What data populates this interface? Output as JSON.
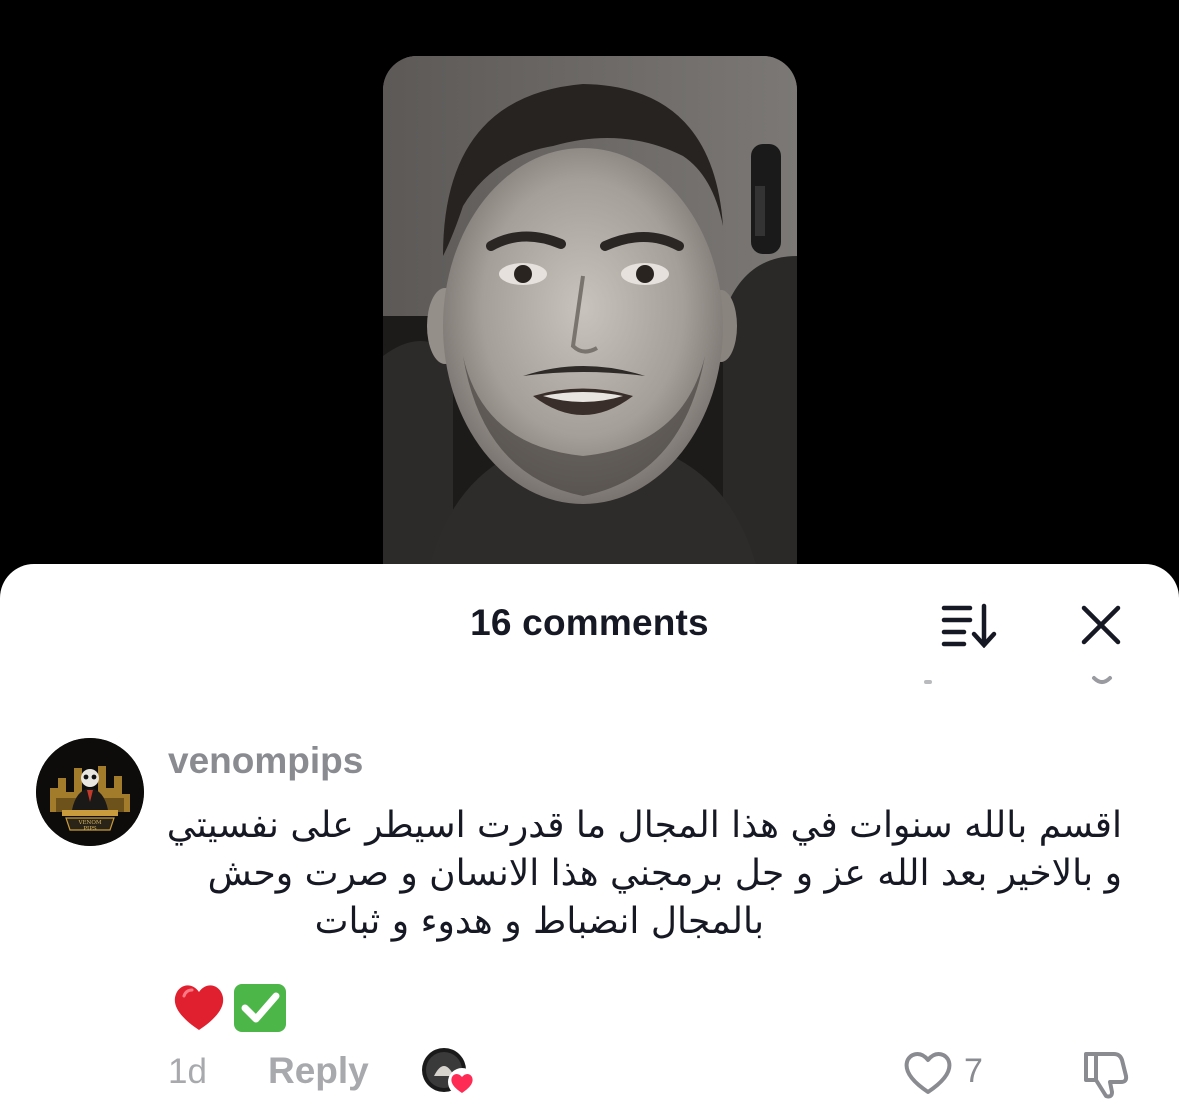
{
  "video": {
    "thumbnail_description_icon": "video-thumbnail"
  },
  "comments_sheet": {
    "title": "16 comments",
    "sort_icon": "sort-icon",
    "close_icon": "close-icon"
  },
  "comment": {
    "username": "venompips",
    "avatar_icon": "venom-pips-logo-avatar",
    "avatar_logo_text": "VENOM PIPS",
    "text_lines": [
      "اقسم بالله سنوات في هذا المجال ما قدرت اسيطر على نفسيتي",
      "و بالاخير بعد الله عز و جل برمجني هذا الانسان و صرت وحش",
      "بالمجال انضباط و هدوء و ثبات"
    ],
    "emojis": [
      "✅",
      "❤️"
    ],
    "time": "1d",
    "reply_label": "Reply",
    "creator_liked_icon": "creator-liked-avatar-heart",
    "like_icon": "heart-outline-icon",
    "like_count": "7",
    "dislike_icon": "thumbs-down-icon"
  },
  "colors": {
    "background": "#000000",
    "sheet": "#ffffff",
    "primary_text": "#161823",
    "secondary_text": "#8a8b91",
    "muted_text": "#a8a9ad",
    "heart_accent": "#fe2c55",
    "emoji_check_green": "#4cb648",
    "emoji_heart_red": "#e0202e"
  }
}
